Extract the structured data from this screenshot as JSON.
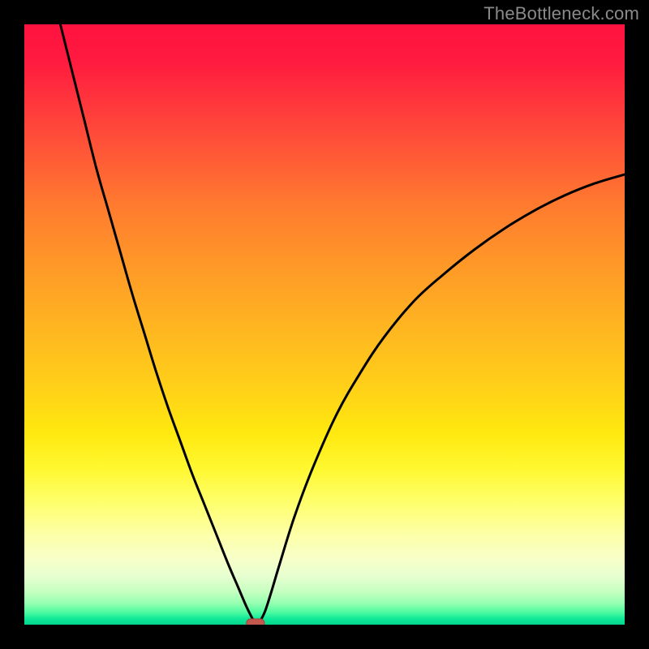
{
  "watermark": "TheBottleneck.com",
  "colors": {
    "frame": "#000000",
    "curve": "#000000",
    "marker_fill": "#c3584f",
    "marker_stroke": "#a84840",
    "gradient_top": "#ff123f",
    "gradient_bottom": "#04d78e"
  },
  "chart_data": {
    "type": "line",
    "title": "",
    "xlabel": "",
    "ylabel": "",
    "xlim": [
      0,
      100
    ],
    "ylim": [
      0,
      100
    ],
    "grid": false,
    "annotations": [],
    "marker": {
      "x": 38.5,
      "y": 0
    },
    "series": [
      {
        "name": "curve",
        "x": [
          6.0,
          8.0,
          10.0,
          12.0,
          14.0,
          16.0,
          18.0,
          20.0,
          22.0,
          24.0,
          26.0,
          28.0,
          30.0,
          32.0,
          34.0,
          35.5,
          37.0,
          38.0,
          38.5,
          39.0,
          40.0,
          41.0,
          42.5,
          45.0,
          48.0,
          52.0,
          56.0,
          60.0,
          65.0,
          70.0,
          75.0,
          80.0,
          85.0,
          90.0,
          95.0,
          100.0
        ],
        "y": [
          100.0,
          92.0,
          84.0,
          76.0,
          69.0,
          62.0,
          55.0,
          48.5,
          42.0,
          36.0,
          30.5,
          25.0,
          20.0,
          15.0,
          10.0,
          6.5,
          3.0,
          1.0,
          0.0,
          0.2,
          2.0,
          5.0,
          10.0,
          18.0,
          26.0,
          35.0,
          42.0,
          48.0,
          54.0,
          58.5,
          62.5,
          66.0,
          69.0,
          71.5,
          73.5,
          75.0
        ]
      }
    ]
  }
}
